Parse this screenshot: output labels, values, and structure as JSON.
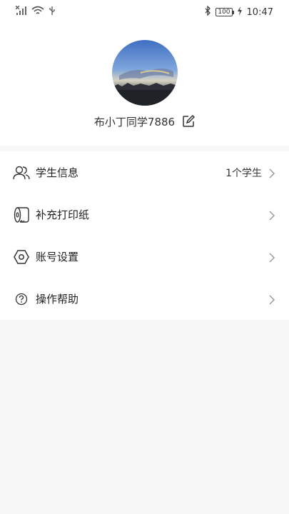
{
  "status_bar": {
    "time": "10:47",
    "battery": "100",
    "icons": [
      "no-signal-icon",
      "wifi-icon",
      "usb-icon",
      "bluetooth-icon",
      "battery-icon",
      "charging-icon"
    ]
  },
  "profile": {
    "username": "布小丁同学7886",
    "avatar_icon": "avatar-sky-photo"
  },
  "menu": {
    "items": [
      {
        "label": "学生信息",
        "value": "1个学生",
        "icon": "users-icon"
      },
      {
        "label": "补充打印纸",
        "value": "",
        "icon": "paper-roll-icon"
      },
      {
        "label": "账号设置",
        "value": "",
        "icon": "settings-hex-icon"
      },
      {
        "label": "操作帮助",
        "value": "",
        "icon": "help-icon"
      }
    ]
  },
  "colors": {
    "background": "#f7f7f7",
    "card": "#ffffff",
    "text": "#222222",
    "chevron": "#9a9a9a"
  }
}
